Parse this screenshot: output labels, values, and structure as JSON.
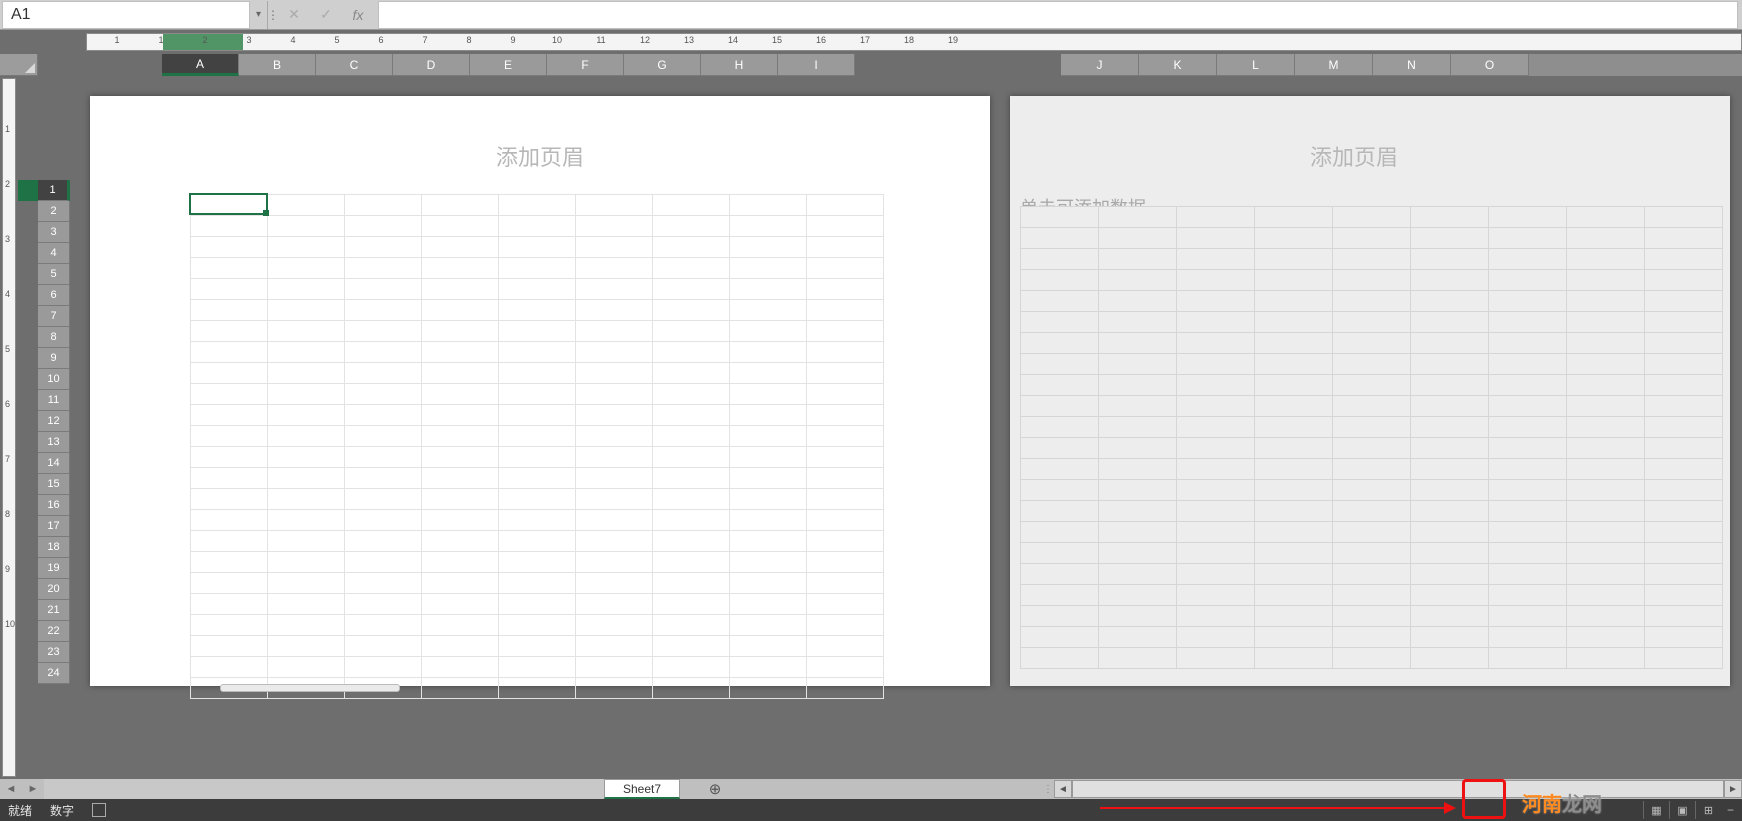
{
  "formula_bar": {
    "name_box_value": "A1",
    "cancel_icon_glyph": "✕",
    "confirm_icon_glyph": "✓",
    "fx_label": "fx",
    "formula_value": ""
  },
  "h_ruler": {
    "ticks": [
      "1",
      "1",
      "2",
      "3",
      "4",
      "5",
      "6",
      "7",
      "8",
      "9",
      "10",
      "11",
      "12",
      "13",
      "14",
      "15",
      "16",
      "17",
      "18",
      "19"
    ]
  },
  "v_ruler": {
    "ticks": [
      "1",
      "2",
      "3",
      "4",
      "5",
      "6",
      "7",
      "8",
      "9",
      "10"
    ]
  },
  "columns_left": [
    "A",
    "B",
    "C",
    "D",
    "E",
    "F",
    "G",
    "H",
    "I"
  ],
  "columns_right": [
    "J",
    "K",
    "L",
    "M",
    "N",
    "O"
  ],
  "active_column": "A",
  "rows": [
    "1",
    "2",
    "3",
    "4",
    "5",
    "6",
    "7",
    "8",
    "9",
    "10",
    "11",
    "12",
    "13",
    "14",
    "15",
    "16",
    "17",
    "18",
    "19",
    "20",
    "21",
    "22",
    "23",
    "24"
  ],
  "active_row": "1",
  "page_left": {
    "header_placeholder": "添加页眉"
  },
  "page_right": {
    "header_placeholder": "添加页眉",
    "click_placeholder": "单击可添加数据"
  },
  "sheet_tabs": {
    "active": "Sheet7"
  },
  "status_bar": {
    "ready": "就绪",
    "num": "数字"
  },
  "watermark": {
    "part1": "河南",
    "part2": "龙网"
  },
  "glyphs": {
    "tri_left": "◄",
    "tri_right": "►",
    "plus_circle": "⊕",
    "dots": "⋮",
    "grid": "▦",
    "page": "▣",
    "break": "⊞",
    "minus": "−"
  }
}
